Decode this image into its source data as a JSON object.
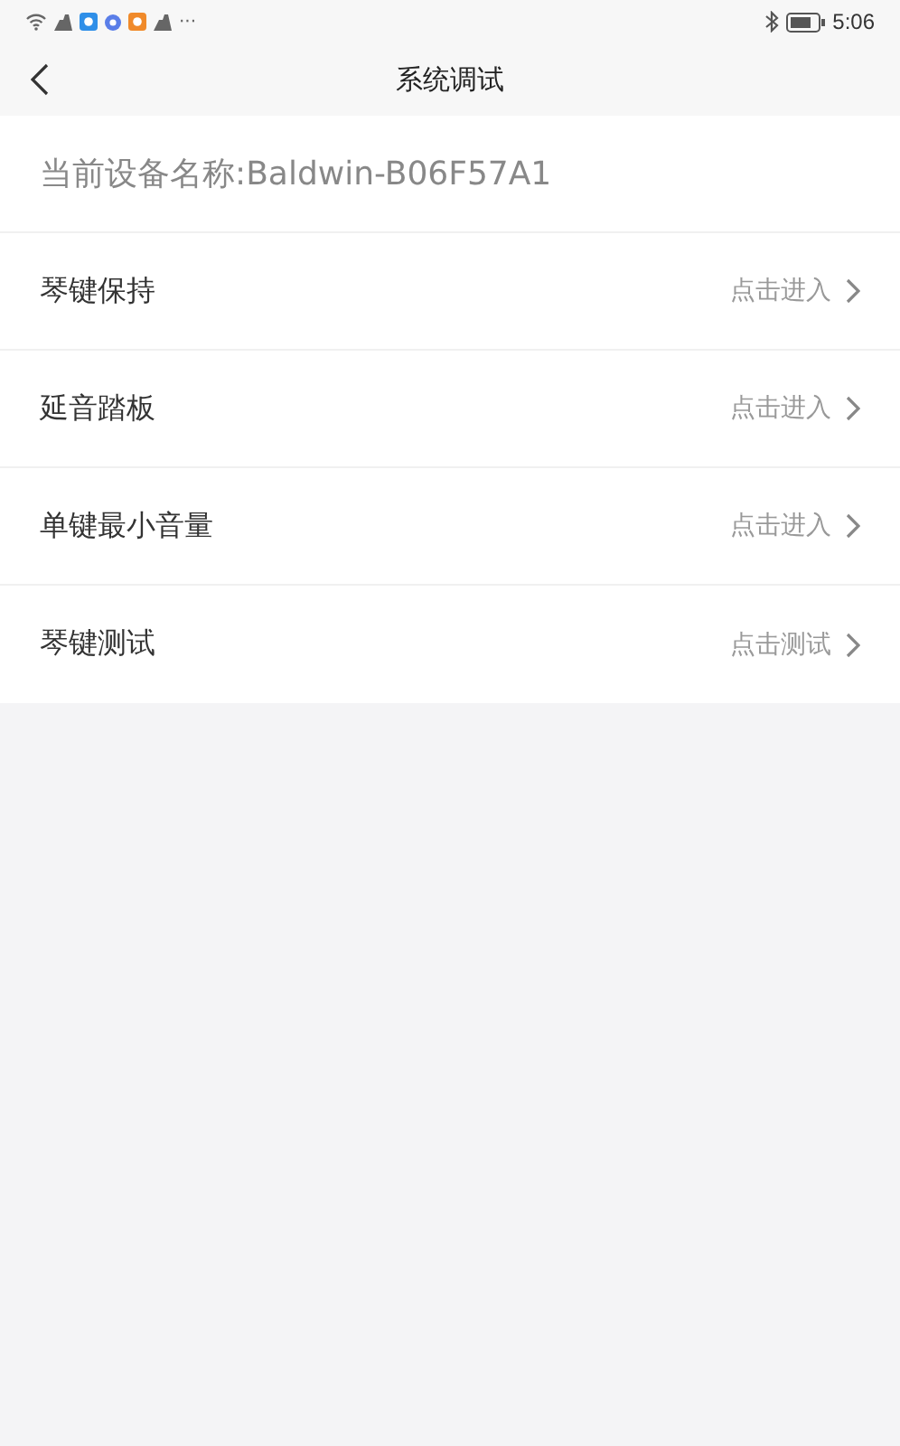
{
  "status_bar": {
    "more": "···",
    "time": "5:06"
  },
  "header": {
    "title": "系统调试"
  },
  "device": {
    "label": "当前设备名称:Baldwin-B06F57A1"
  },
  "items": [
    {
      "label": "琴键保持",
      "action": "点击进入"
    },
    {
      "label": "延音踏板",
      "action": "点击进入"
    },
    {
      "label": "单键最小音量",
      "action": "点击进入"
    },
    {
      "label": "琴键测试",
      "action": "点击测试"
    }
  ]
}
